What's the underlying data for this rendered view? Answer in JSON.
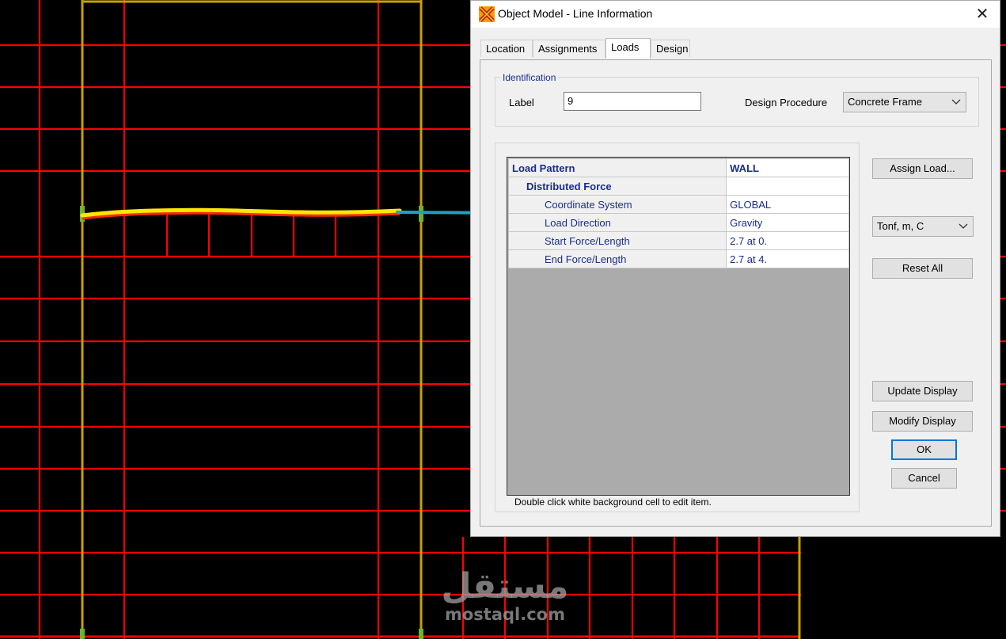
{
  "window": {
    "title": "Object Model - Line Information",
    "close_glyph": "✕",
    "app_icon": "etabs-icon"
  },
  "tabs": [
    {
      "label": "Location"
    },
    {
      "label": "Assignments"
    },
    {
      "label": "Loads",
      "active": true
    },
    {
      "label": "Design"
    }
  ],
  "identification": {
    "title": "Identification",
    "label_caption": "Label",
    "label_value": "9",
    "design_procedure_caption": "Design Procedure",
    "design_procedure_value": "Concrete Frame"
  },
  "load_table": {
    "header": {
      "name": "Load Pattern",
      "value": "WALL"
    },
    "section": "Distributed Force",
    "rows": [
      {
        "name": "Coordinate System",
        "value": "GLOBAL"
      },
      {
        "name": "Load Direction",
        "value": "Gravity"
      },
      {
        "name": "Start Force/Length",
        "value": "2.7 at 0."
      },
      {
        "name": "End Force/Length",
        "value": "2.7 at 4."
      }
    ]
  },
  "hint": "Double click white background cell to edit item.",
  "buttons": {
    "assign_load": "Assign Load...",
    "units": "Tonf, m, C",
    "reset_all": "Reset All",
    "update_display": "Update Display",
    "modify_display": "Modify Display",
    "ok": "OK",
    "cancel": "Cancel"
  },
  "watermark": {
    "arabic": "مستقل",
    "latin": "mostaql.com"
  },
  "colors": {
    "grid_lines": "#ff0000",
    "frame_lines": "#c8a000",
    "highlight": "#ffe600",
    "arrow": "#1ea0c8",
    "label_blue": "#1a2d8c"
  }
}
